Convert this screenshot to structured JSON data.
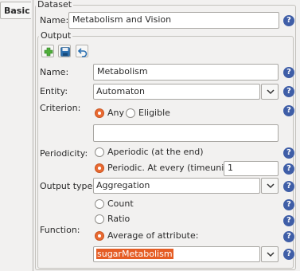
{
  "tabs": {
    "basic": "Basic"
  },
  "dataset": {
    "title": "Dataset",
    "name_label": "Name:",
    "name_value": "Metabolism and Vision"
  },
  "output": {
    "title": "Output",
    "name_label": "Name:",
    "name_value": "Metabolism",
    "entity_label": "Entity:",
    "entity_value": "Automaton",
    "criterion_label": "Criterion:",
    "criterion_any": "Any",
    "criterion_eligible": "Eligible",
    "periodicity_label": "Periodicity:",
    "aperiodic": "Aperiodic (at the end)",
    "periodic": "Periodic. At every (timeunits):",
    "periodic_value": "1",
    "output_type_label": "Output type:",
    "output_type_value": "Aggregation",
    "function_label": "Function:",
    "fn_count": "Count",
    "fn_ratio": "Ratio",
    "fn_average": "Average of attribute:",
    "attribute_value": "sugarMetabolism"
  },
  "help": {
    "symbol": "?"
  },
  "icons": {
    "add": "add-icon",
    "save": "save-icon",
    "undo": "undo-icon"
  },
  "colors": {
    "accent": "#e96a32",
    "help": "#3f5ea7"
  }
}
